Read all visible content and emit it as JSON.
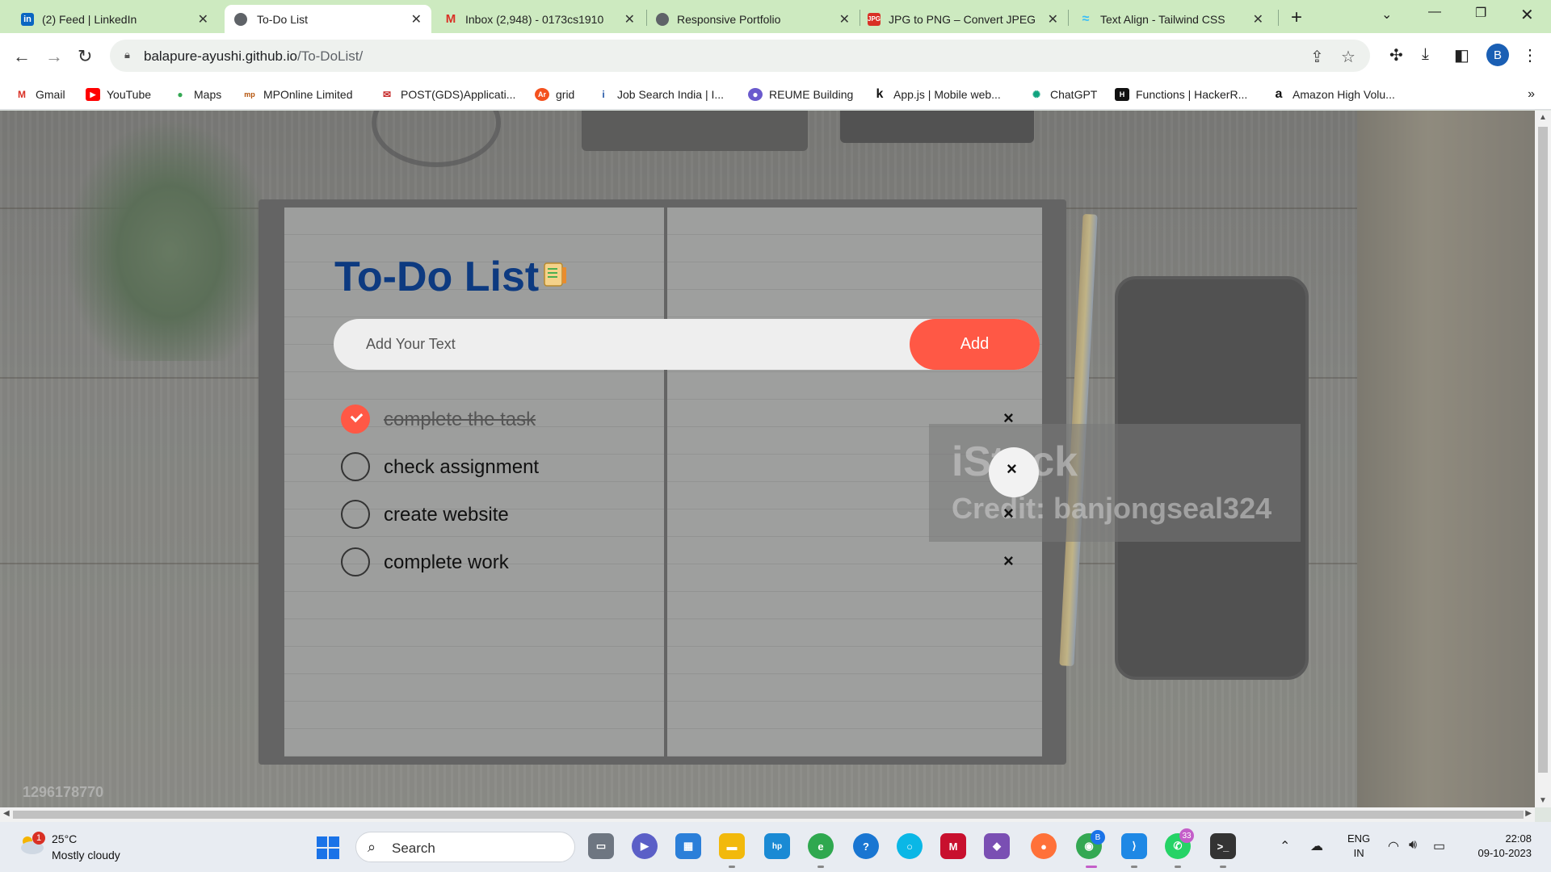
{
  "browser": {
    "tabs": [
      {
        "title": "(2) Feed | LinkedIn",
        "icon": "linkedin-icon",
        "active": false
      },
      {
        "title": "To-Do List",
        "icon": "globe-icon",
        "active": true
      },
      {
        "title": "Inbox (2,948) - 0173cs1910",
        "icon": "gmail-icon",
        "active": false
      },
      {
        "title": "Responsive Portfolio",
        "icon": "globe-icon",
        "active": false
      },
      {
        "title": "JPG to PNG – Convert JPEG",
        "icon": "jpg-png-icon",
        "active": false
      },
      {
        "title": "Text Align - Tailwind CSS",
        "icon": "tailwind-icon",
        "active": false
      }
    ],
    "url_domain": "balapure-ayushi.github.io",
    "url_path": "/To-DoList/",
    "profile_initial": "B",
    "bookmarks": [
      {
        "label": "Gmail",
        "icon": "gmail-icon"
      },
      {
        "label": "YouTube",
        "icon": "youtube-icon"
      },
      {
        "label": "Maps",
        "icon": "maps-icon"
      },
      {
        "label": "MPOnline Limited",
        "icon": "mponline-icon"
      },
      {
        "label": "POST(GDS)Applicati...",
        "icon": "post-icon"
      },
      {
        "label": "grid",
        "icon": "grid-icon"
      },
      {
        "label": "Job Search India | I...",
        "icon": "indeed-icon"
      },
      {
        "label": "REUME Building",
        "icon": "resume-icon"
      },
      {
        "label": "App.js | Mobile web...",
        "icon": "appjs-icon"
      },
      {
        "label": "ChatGPT",
        "icon": "chatgpt-icon"
      },
      {
        "label": "Functions | HackerR...",
        "icon": "hackerrank-icon"
      },
      {
        "label": "Amazon High Volu...",
        "icon": "amazon-icon"
      }
    ],
    "bookmarks_more": "»"
  },
  "page": {
    "title": "To-Do List",
    "input_placeholder": "Add Your Text",
    "add_label": "Add",
    "accent_color": "#ff5845",
    "title_color": "#0d3a80",
    "watermark": "iStock",
    "credit": "Credit: banjongseal324",
    "stock_id": "1296178770",
    "tasks": [
      {
        "text": "complete the task",
        "done": true
      },
      {
        "text": "check assignment",
        "done": false
      },
      {
        "text": "create website",
        "done": false
      },
      {
        "text": "complete work",
        "done": false
      }
    ],
    "delete_glyph": "×"
  },
  "taskbar": {
    "weather_temp": "25°C",
    "weather_desc": "Mostly cloudy",
    "weather_badge": "1",
    "search_label": "Search",
    "whatsapp_badge": "33",
    "chrome_badge": "B",
    "lang_line1": "ENG",
    "lang_line2": "IN",
    "time": "22:08",
    "date": "09-10-2023"
  }
}
